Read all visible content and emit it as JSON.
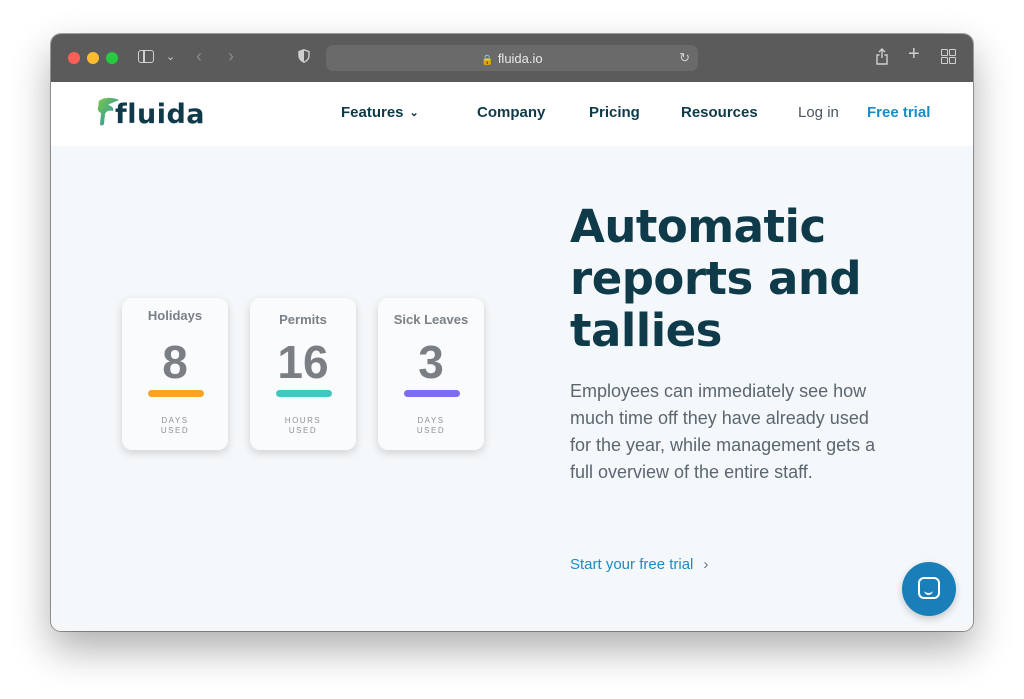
{
  "browser": {
    "url": "fluida.io",
    "icons": [
      "sidebar-icon",
      "chevron-down-icon",
      "back-icon",
      "forward-icon",
      "shield-icon",
      "lock-icon",
      "reload-icon",
      "share-icon",
      "plus-icon",
      "tabs-grid-icon"
    ]
  },
  "header": {
    "logo_text": "fluida",
    "nav": {
      "features": "Features",
      "company": "Company",
      "pricing": "Pricing",
      "resources": "Resources",
      "login": "Log in",
      "free_trial": "Free trial"
    }
  },
  "cards": [
    {
      "title": "Holidays",
      "value": "8",
      "unit_line1": "DAYS",
      "unit_line2": "USED",
      "bar_color": "#f5a623"
    },
    {
      "title": "Permits",
      "value": "16",
      "unit_line1": "HOURS",
      "unit_line2": "USED",
      "bar_color": "#3fc8c0"
    },
    {
      "title": "Sick Leaves",
      "value": "3",
      "unit_line1": "DAYS",
      "unit_line2": "USED",
      "bar_color": "#7b6cf0"
    }
  ],
  "hero": {
    "title": "Automatic reports and tallies",
    "body": "Employees can immediately see how much time off they have already used for the year, while management gets a full overview of the entire staff.",
    "cta": "Start your free trial"
  },
  "colors": {
    "brand_dark": "#0e3a4a",
    "accent_blue": "#1a8cc5",
    "chat_blue": "#1a7fb8"
  }
}
